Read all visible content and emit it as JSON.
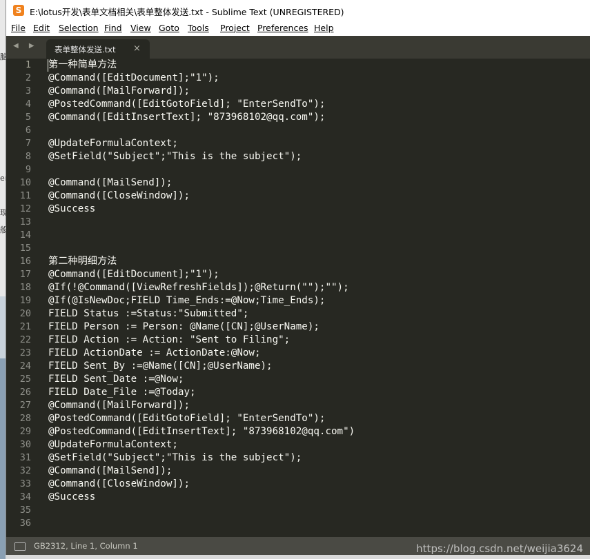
{
  "window": {
    "title": "E:\\lotus开发\\表单文档相关\\表单整体发送.txt - Sublime Text (UNREGISTERED)",
    "app_icon": "S"
  },
  "menu": [
    "File",
    "Edit",
    "Selection",
    "Find",
    "View",
    "Goto",
    "Tools",
    "Project",
    "Preferences",
    "Help"
  ],
  "tabs": {
    "nav_arrows": "◀ ▶",
    "active": {
      "label": "表单整体发送.txt",
      "close": "×"
    }
  },
  "editor": {
    "lines": [
      {
        "n": "1",
        "text": "第一种简单方法"
      },
      {
        "n": "2",
        "text": "@Command([EditDocument];\"1\");"
      },
      {
        "n": "3",
        "text": "@Command([MailForward]);"
      },
      {
        "n": "4",
        "text": "@PostedCommand([EditGotoField]; \"EnterSendTo\");"
      },
      {
        "n": "5",
        "text": "@Command([EditInsertText]; \"873968102@qq.com\");"
      },
      {
        "n": "6",
        "text": ""
      },
      {
        "n": "7",
        "text": "@UpdateFormulaContext;"
      },
      {
        "n": "8",
        "text": "@SetField(\"Subject\";\"This is the subject\");"
      },
      {
        "n": "9",
        "text": ""
      },
      {
        "n": "10",
        "text": "@Command([MailSend]);"
      },
      {
        "n": "11",
        "text": "@Command([CloseWindow]);"
      },
      {
        "n": "12",
        "text": "@Success"
      },
      {
        "n": "13",
        "text": ""
      },
      {
        "n": "14",
        "text": ""
      },
      {
        "n": "15",
        "text": ""
      },
      {
        "n": "16",
        "text": "第二种明细方法"
      },
      {
        "n": "17",
        "text": "@Command([EditDocument];\"1\");"
      },
      {
        "n": "18",
        "text": "@If(!@Command([ViewRefreshFields]);@Return(\"\");\"\");"
      },
      {
        "n": "19",
        "text": "@If(@IsNewDoc;FIELD Time_Ends:=@Now;Time_Ends);"
      },
      {
        "n": "20",
        "text": "FIELD Status :=Status:\"Submitted\";"
      },
      {
        "n": "21",
        "text": "FIELD Person := Person: @Name([CN];@UserName);"
      },
      {
        "n": "22",
        "text": "FIELD Action := Action: \"Sent to Filing\";"
      },
      {
        "n": "23",
        "text": "FIELD ActionDate := ActionDate:@Now;"
      },
      {
        "n": "24",
        "text": "FIELD Sent_By :=@Name([CN];@UserName);"
      },
      {
        "n": "25",
        "text": "FIELD Sent_Date :=@Now;"
      },
      {
        "n": "26",
        "text": "FIELD Date_File :=@Today;"
      },
      {
        "n": "27",
        "text": "@Command([MailForward]);"
      },
      {
        "n": "28",
        "text": "@PostedCommand([EditGotoField]; \"EnterSendTo\");"
      },
      {
        "n": "29",
        "text": "@PostedCommand([EditInsertText]; \"873968102@qq.com\")"
      },
      {
        "n": "30",
        "text": "@UpdateFormulaContext;"
      },
      {
        "n": "31",
        "text": "@SetField(\"Subject\";\"This is the subject\");"
      },
      {
        "n": "32",
        "text": "@Command([MailSend]);"
      },
      {
        "n": "33",
        "text": "@Command([CloseWindow]);"
      },
      {
        "n": "34",
        "text": "@Success"
      },
      {
        "n": "35",
        "text": ""
      },
      {
        "n": "36",
        "text": ""
      }
    ]
  },
  "status": {
    "text": "GB2312, Line 1, Column 1"
  },
  "watermark": "https://blog.csdn.net/weijia3624",
  "background_fragments": [
    "脑",
    "er",
    "现",
    "般"
  ],
  "colors": {
    "editor_bg": "#272822",
    "text": "#f8f8f2",
    "gutter_text": "#8f908a",
    "accent_icon": "#f0821e"
  }
}
